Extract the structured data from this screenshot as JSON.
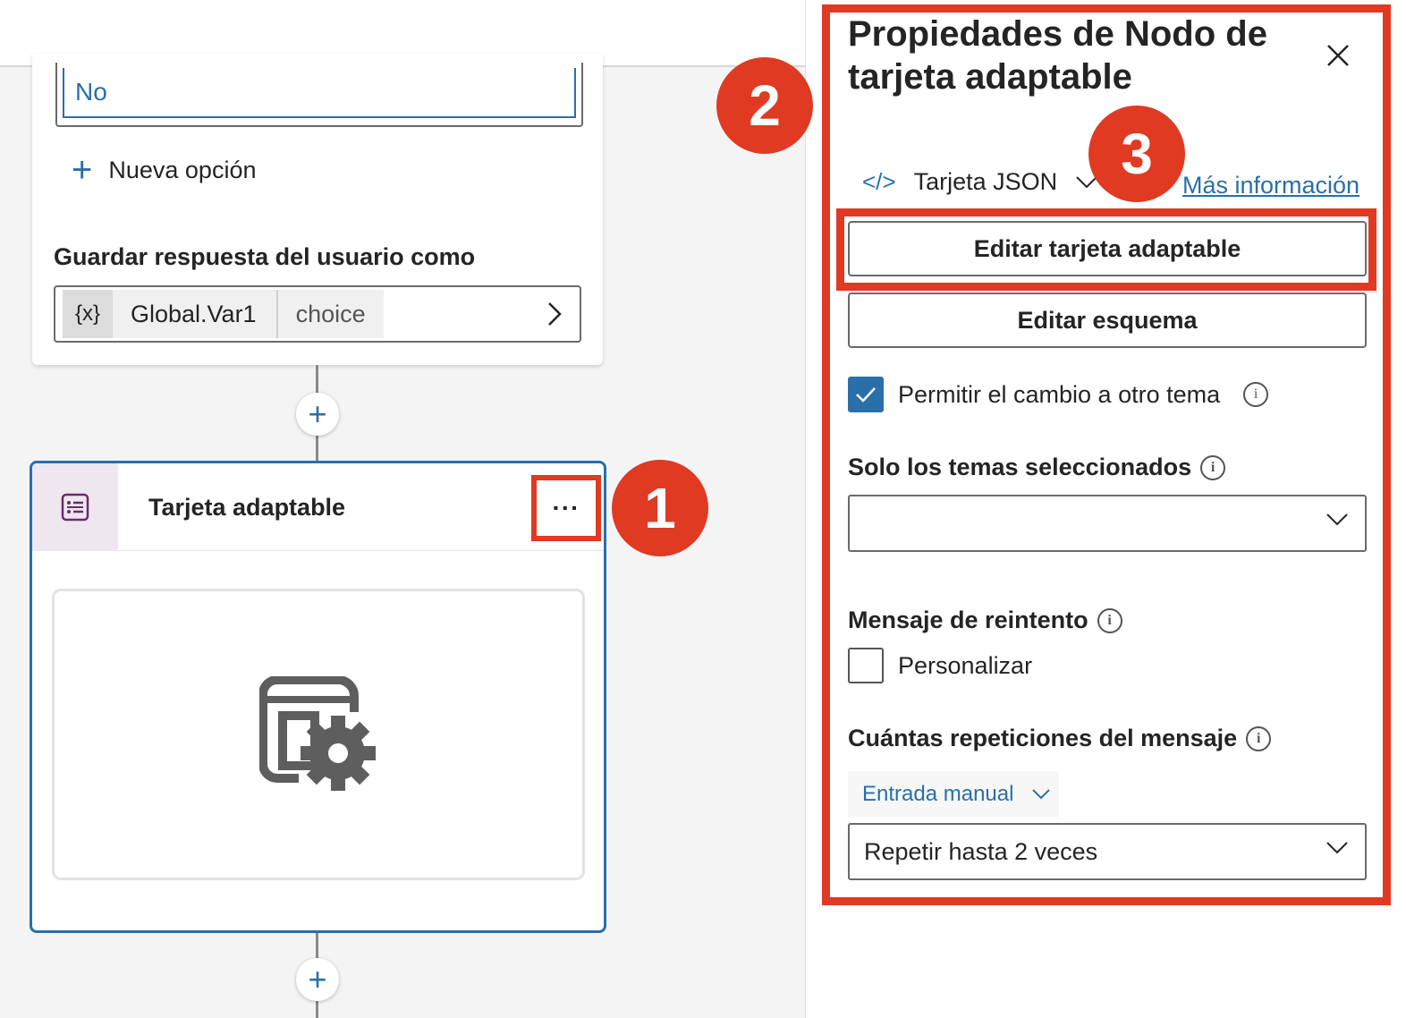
{
  "canvas": {
    "option_value": "No",
    "new_option_label": "Nueva opción",
    "save_response_label": "Guardar respuesta del usuario como",
    "variable": {
      "symbol": "{x}",
      "name": "Global.Var1",
      "type": "choice"
    },
    "adaptive_card_node": {
      "title": "Tarjeta adaptable",
      "more_label": "···"
    }
  },
  "badges": [
    "1",
    "2",
    "3"
  ],
  "panel": {
    "title": "Propiedades de Nodo de tarjeta adaptable",
    "card_source": "Tarjeta JSON",
    "more_info": "Más información",
    "edit_card_button": "Editar tarjeta adaptable",
    "edit_schema_button": "Editar esquema",
    "allow_switch": {
      "label": "Permitir el cambio a otro tema",
      "checked": true
    },
    "selected_topics_label": "Solo los temas seleccionados",
    "selected_topics_value": "",
    "retry_message_label": "Mensaje de reintento",
    "customize": {
      "label": "Personalizar",
      "checked": false
    },
    "repeat_count_label": "Cuántas repeticiones del mensaje",
    "manual_entry_label": "Entrada manual",
    "repeat_value": "Repetir hasta 2 veces"
  },
  "colors": {
    "accent": "#2a6fa8",
    "highlight": "#e03a23",
    "node_icon_bg": "#efe7ef"
  }
}
